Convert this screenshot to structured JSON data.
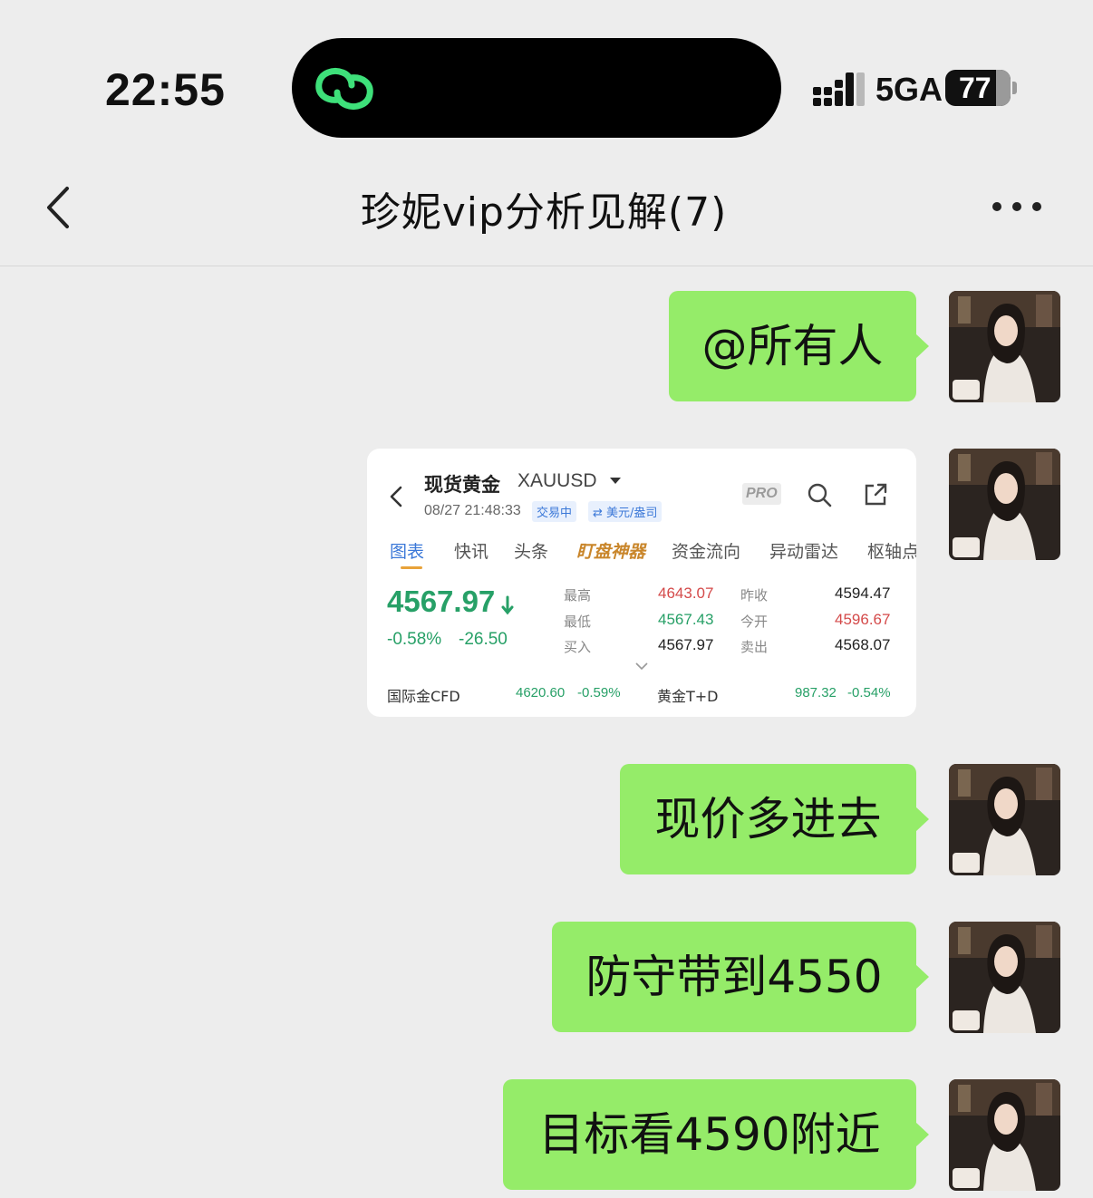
{
  "status_bar": {
    "time": "22:55",
    "network": "5GA",
    "battery": "77",
    "battery_level_percent": 77
  },
  "nav": {
    "title": "珍妮vip分析见解(7)"
  },
  "messages": [
    {
      "type": "text",
      "text": "@所有人"
    },
    {
      "type": "image"
    },
    {
      "type": "text",
      "text": "现价多进去"
    },
    {
      "type": "text",
      "text": "防守带到4550"
    },
    {
      "type": "text",
      "text": "目标看4590附近"
    }
  ],
  "quote_card": {
    "name": "现货黄金",
    "symbol": "XAUUSD",
    "datetime": "08/27 21:48:33",
    "status_badge": "交易中",
    "currency_badge": "⇄ 美元/盎司",
    "pro_label": "PRO",
    "tabs": [
      "图表",
      "快讯",
      "头条",
      "盯盘神器",
      "资金流向",
      "异动雷达",
      "枢轴点"
    ],
    "price": "4567.97",
    "change_pct": "-0.58%",
    "change_abs": "-26.50",
    "stats": [
      {
        "label": "最高",
        "value": "4643.07",
        "label2": "昨收",
        "value2": "4594.47"
      },
      {
        "label": "最低",
        "value": "4567.43",
        "label2": "今开",
        "value2": "4596.67"
      },
      {
        "label": "买入",
        "value": "4567.97",
        "label2": "卖出",
        "value2": "4568.07"
      }
    ],
    "footer": [
      {
        "name": "国际金CFD",
        "price": "4620.60",
        "change": "-0.59%"
      },
      {
        "name": "黄金T+D",
        "price": "987.32",
        "change": "-0.54%"
      }
    ]
  }
}
